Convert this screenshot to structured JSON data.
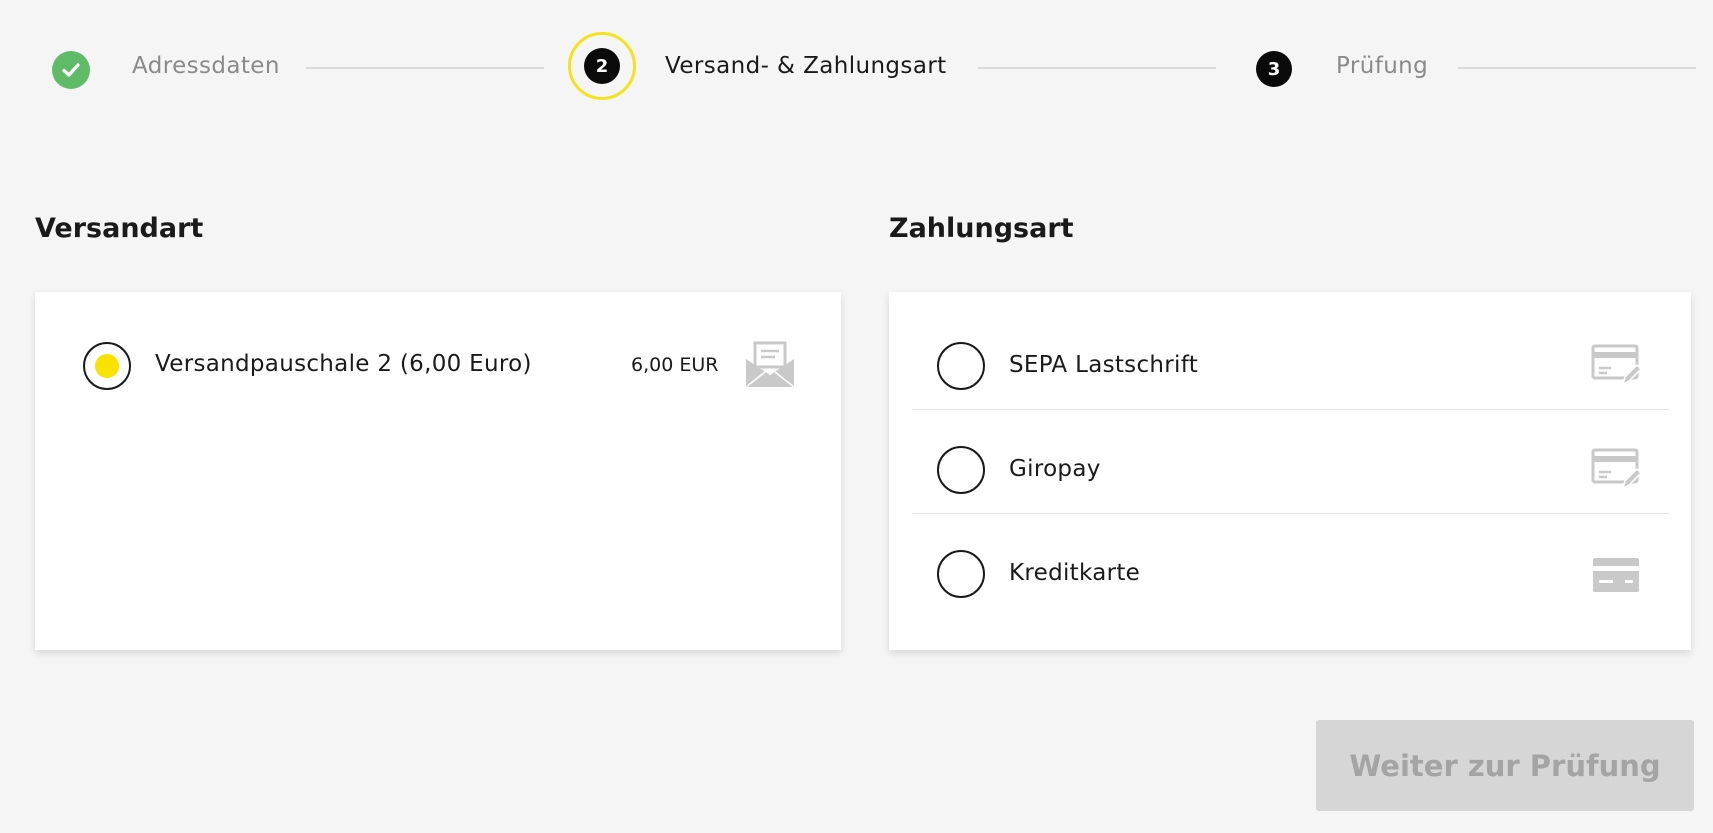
{
  "stepper": {
    "steps": [
      {
        "label": "Adressdaten",
        "state": "done"
      },
      {
        "label": "Versand- & Zahlungsart",
        "state": "active",
        "number": "2"
      },
      {
        "label": "Prüfung",
        "state": "todo",
        "number": "3"
      }
    ]
  },
  "shipping": {
    "title": "Versandart",
    "options": [
      {
        "label": "Versandpauschale 2 (6,00 Euro)",
        "price": "6,00 EUR",
        "selected": true,
        "icon": "open-envelope-icon"
      }
    ]
  },
  "payment": {
    "title": "Zahlungsart",
    "options": [
      {
        "label": "SEPA Lastschrift",
        "selected": false,
        "icon": "card-with-pen-icon"
      },
      {
        "label": "Giropay",
        "selected": false,
        "icon": "card-with-pen-icon"
      },
      {
        "label": "Kreditkarte",
        "selected": false,
        "icon": "credit-card-icon"
      }
    ]
  },
  "actions": {
    "next_label": "Weiter zur Prüfung"
  },
  "colors": {
    "accent_yellow": "#f7e200",
    "ring_yellow": "#f3e31d",
    "success_green": "#5fbb68",
    "button_disabled_bg": "#d6d6d6",
    "button_disabled_text": "#a4a4a4"
  }
}
